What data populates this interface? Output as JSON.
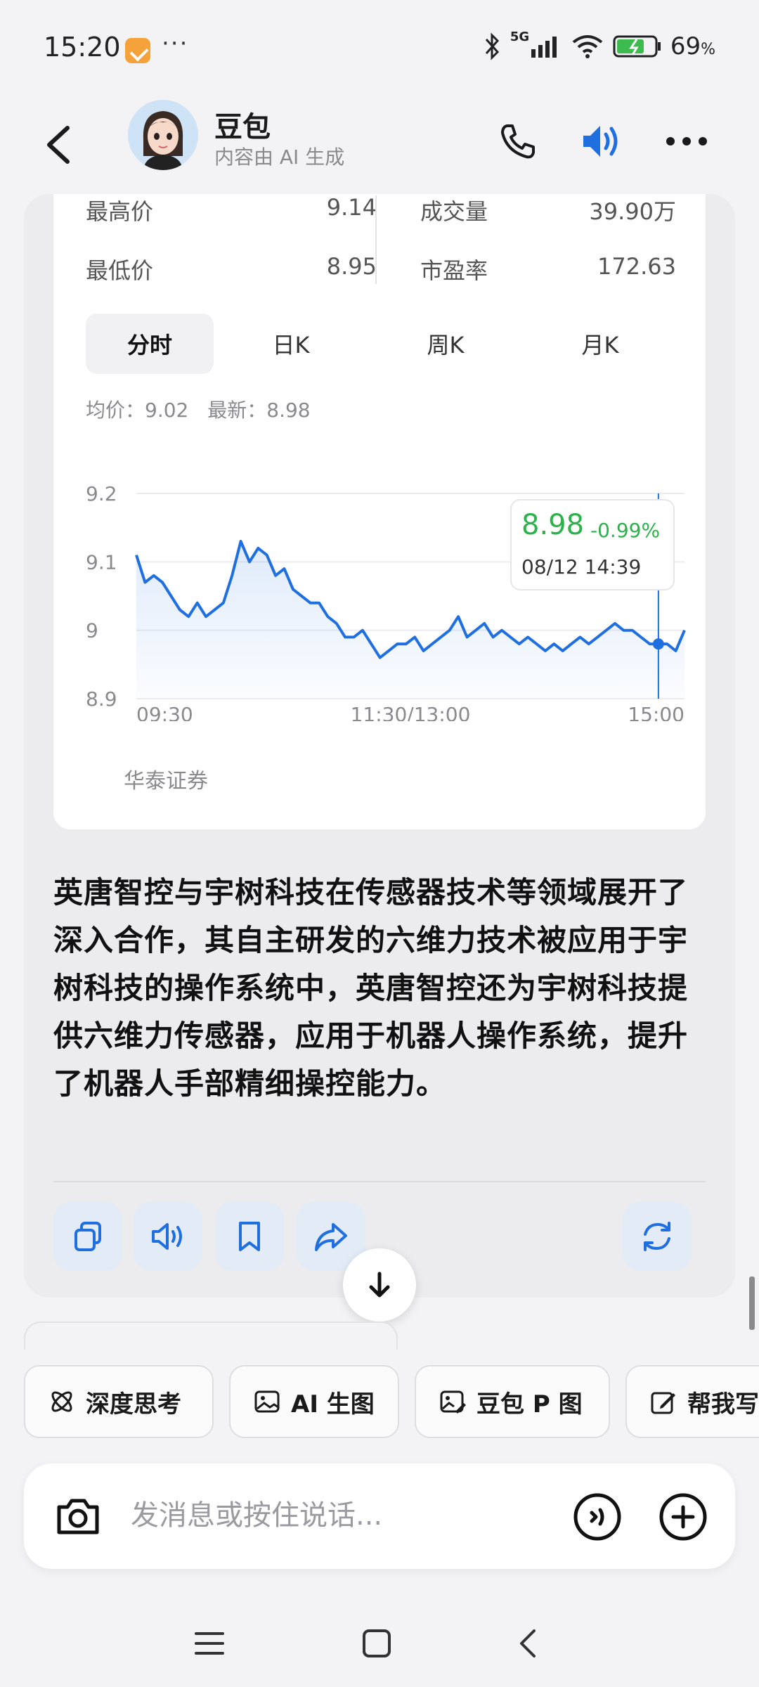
{
  "status_bar": {
    "time": "15:20",
    "dots": "···",
    "network": "5G",
    "battery_percent": "69",
    "battery_suffix": "%"
  },
  "header": {
    "title": "豆包",
    "subtitle": "内容由 AI 生成"
  },
  "stock": {
    "stats": {
      "high_label": "最高价",
      "high_value": "9.14",
      "low_label": "最低价",
      "low_value": "8.95",
      "volume_label": "成交量",
      "volume_value": "39.90万",
      "pe_label": "市盈率",
      "pe_value": "172.63"
    },
    "tabs": [
      "分时",
      "日K",
      "周K",
      "月K"
    ],
    "active_tab": "分时",
    "avg_price": "均价：9.02",
    "latest_price": "最新：8.98",
    "tooltip": {
      "price": "8.98",
      "change": "-0.99%",
      "time": "08/12 14:39"
    },
    "source": "华泰证券"
  },
  "chart_data": {
    "type": "line",
    "xlabel": "",
    "ylabel": "",
    "ylim": [
      8.9,
      9.2
    ],
    "y_ticks": [
      "9.2",
      "9.1",
      "9",
      "8.9"
    ],
    "x_ticks": [
      "09:30",
      "11:30/13:00",
      "15:00"
    ],
    "grid": true,
    "line_color": "#1f6fe0",
    "series": [
      {
        "values": [
          9.11,
          9.07,
          9.08,
          9.07,
          9.05,
          9.03,
          9.02,
          9.04,
          9.02,
          9.03,
          9.04,
          9.08,
          9.13,
          9.1,
          9.12,
          9.11,
          9.08,
          9.09,
          9.06,
          9.05,
          9.04,
          9.04,
          9.02,
          9.01,
          8.99,
          8.99,
          9.0,
          8.98,
          8.96,
          8.97,
          8.98,
          8.98,
          8.99,
          8.97,
          8.98,
          8.99,
          9.0,
          9.02,
          8.99,
          9.0,
          9.01,
          8.99,
          9.0,
          8.99,
          8.98,
          8.99,
          8.98,
          8.97,
          8.98,
          8.97,
          8.98,
          8.99,
          8.98,
          8.99,
          9.0,
          9.01,
          9.0,
          9.0,
          8.99,
          8.98,
          8.98,
          8.98,
          8.97,
          9.0
        ],
        "last_point": 8.98
      }
    ]
  },
  "message": {
    "text": "英唐智控与宇树科技在传感器技术等领域展开了深入合作，其自主研发的六维力技术被应用于宇树科技的操作系统中，英唐智控还为宇树科技提供六维力传感器，应用于机器人操作系统，提升了机器人手部精细操控能力。"
  },
  "actions": [
    "copy-icon",
    "speaker-icon",
    "bookmark-icon",
    "share-icon",
    "refresh-icon"
  ],
  "chips": [
    {
      "label": "深度思考",
      "icon": "atom-icon"
    },
    {
      "label": "AI 生图",
      "icon": "image-icon"
    },
    {
      "label": "豆包 P 图",
      "icon": "photo-edit-icon"
    },
    {
      "label": "帮我写",
      "icon": "edit-icon"
    }
  ],
  "input": {
    "placeholder": "发消息或按住说话..."
  },
  "colors": {
    "accent": "#1f6fe0",
    "up_green": "#2bb24c",
    "background": "#f3f3f5"
  }
}
